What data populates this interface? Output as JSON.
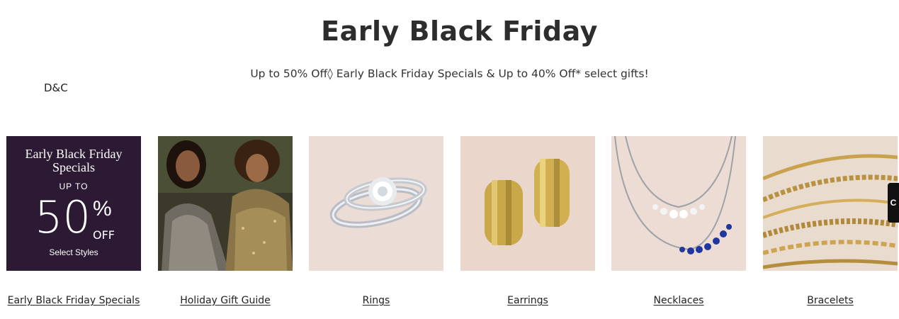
{
  "hero": {
    "title": "Early Black Friday",
    "subtitle": "Up to 50% Off◊ Early Black Friday Specials & Up to 40% Off* select gifts!"
  },
  "brand_label": "D&C",
  "promo_tile": {
    "line1": "Early Black Friday Specials",
    "line2": "UP TO",
    "percent_number": "50",
    "percent_sign": "%",
    "off": "OFF",
    "styles": "Select Styles"
  },
  "categories": [
    {
      "label": "Early Black Friday Specials",
      "image": "promo-banner"
    },
    {
      "label": "Holiday Gift Guide",
      "image": "holiday-photo"
    },
    {
      "label": "Rings",
      "image": "diamond-rings"
    },
    {
      "label": "Earrings",
      "image": "gold-hoop-earrings"
    },
    {
      "label": "Necklaces",
      "image": "sapphire-necklaces"
    },
    {
      "label": "Bracelets",
      "image": "gold-chain-bracelets"
    }
  ],
  "side_tab": {
    "label": "C"
  },
  "colors": {
    "promo_bg": "#2c1a34",
    "text": "#2d2d2d"
  }
}
